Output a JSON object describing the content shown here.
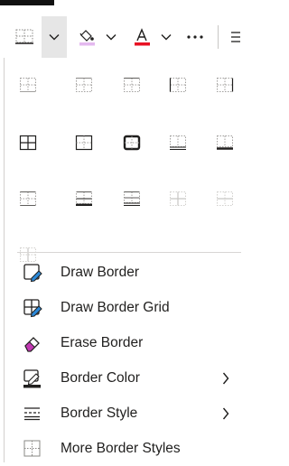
{
  "toolbar": {
    "buttons": [
      {
        "name": "borders-button",
        "icon": "borders-icon"
      },
      {
        "name": "borders-dropdown-button",
        "icon": "chevron-down-icon"
      },
      {
        "name": "fill-color-button",
        "icon": "paint-bucket-icon"
      },
      {
        "name": "fill-color-dropdown-button",
        "icon": "chevron-down-icon"
      },
      {
        "name": "font-color-button",
        "icon": "font-color-icon"
      },
      {
        "name": "font-color-dropdown-button",
        "icon": "chevron-down-icon"
      },
      {
        "name": "more-options-button",
        "icon": "ellipsis-icon",
        "label": "···"
      },
      {
        "name": "align-button",
        "icon": "align-lines-icon"
      }
    ],
    "colors": {
      "fill_swatch": "#e4b9ef",
      "font_swatch": "#e81123"
    }
  },
  "border_presets": [
    {
      "name": "bottom-border",
      "icon": "bottom-border-icon"
    },
    {
      "name": "top-border",
      "icon": "top-border-icon"
    },
    {
      "name": "left-border",
      "icon": "left-border-icon"
    },
    {
      "name": "right-border",
      "icon": "right-border-icon"
    },
    {
      "name": "no-border",
      "icon": "no-border-icon"
    },
    {
      "name": "all-borders",
      "icon": "all-borders-icon"
    },
    {
      "name": "outside-borders",
      "icon": "outside-borders-icon"
    },
    {
      "name": "thick-outside-borders",
      "icon": "thick-outside-borders-icon"
    },
    {
      "name": "bottom-double-border",
      "icon": "bottom-double-border-icon"
    },
    {
      "name": "thick-bottom-border",
      "icon": "thick-bottom-border-icon"
    },
    {
      "name": "top-and-bottom-border",
      "icon": "top-and-bottom-border-icon"
    },
    {
      "name": "top-and-thick-bottom-border",
      "icon": "top-thick-bottom-border-icon"
    },
    {
      "name": "top-and-double-bottom-border",
      "icon": "top-double-bottom-border-icon"
    },
    {
      "name": "inside-borders",
      "icon": "inside-borders-icon"
    },
    {
      "name": "inside-horizontal-border",
      "icon": "inside-horizontal-border-icon"
    },
    {
      "name": "inside-vertical-border",
      "icon": "inside-vertical-border-icon"
    }
  ],
  "menu": {
    "draw_border": {
      "label": "Draw Border",
      "icon": "draw-border-icon"
    },
    "draw_border_grid": {
      "label": "Draw Border Grid",
      "icon": "draw-border-grid-icon"
    },
    "erase_border": {
      "label": "Erase Border",
      "icon": "eraser-icon"
    },
    "border_color": {
      "label": "Border Color",
      "icon": "border-color-icon",
      "has_submenu": true
    },
    "border_style": {
      "label": "Border Style",
      "icon": "border-style-icon",
      "has_submenu": true
    },
    "more_border_styles": {
      "label": "More Border Styles",
      "icon": "more-border-styles-icon"
    }
  },
  "accent": "#2b579a"
}
